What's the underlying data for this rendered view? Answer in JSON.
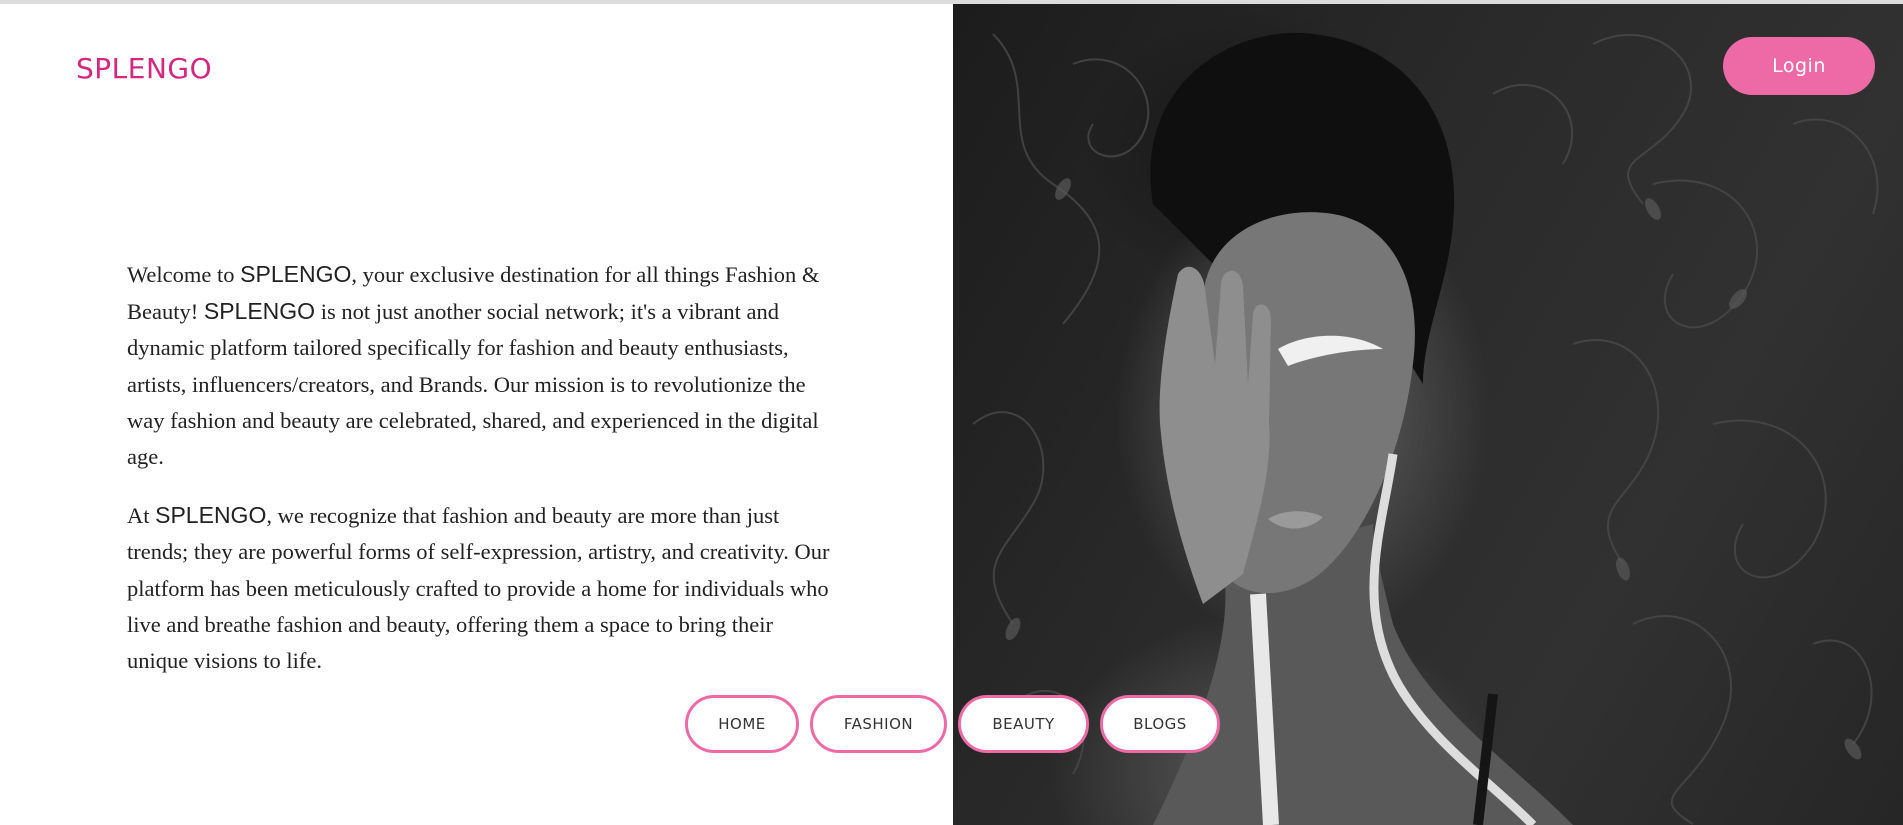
{
  "brand": {
    "name": "SPLENGO",
    "color": "#d6277f"
  },
  "header": {
    "login_label": "Login",
    "login_color": "#ee6aa7"
  },
  "intro": {
    "p1": {
      "a": "Welcome to ",
      "b": "SPLENGO",
      "c": ", your exclusive destination for all things Fashion & Beauty! ",
      "d": "SPLENGO",
      "e": " is not just another social network; it's a vibrant and dynamic platform tailored specifically for fashion and beauty enthusiasts, artists, influencers/creators, and Brands. Our mission is to revolutionize the way fashion and beauty are celebrated, shared, and experienced in the digital age."
    },
    "p2": {
      "a": "At ",
      "b": "SPLENGO",
      "c": ", we recognize that fashion and beauty are more than just trends; they are powerful forms of self-expression, artistry, and creativity. Our platform has been meticulously crafted to provide a home for individuals who live and breathe fashion and beauty, offering them a space to bring their unique visions to life."
    }
  },
  "nav": {
    "items": [
      {
        "label": "HOME"
      },
      {
        "label": "FASHION"
      },
      {
        "label": "BEAUTY"
      },
      {
        "label": "BLOGS"
      }
    ],
    "border_color": "#ee6aa7"
  },
  "hero": {
    "image": "black-and-white portrait photo of a woman with white body paint"
  }
}
